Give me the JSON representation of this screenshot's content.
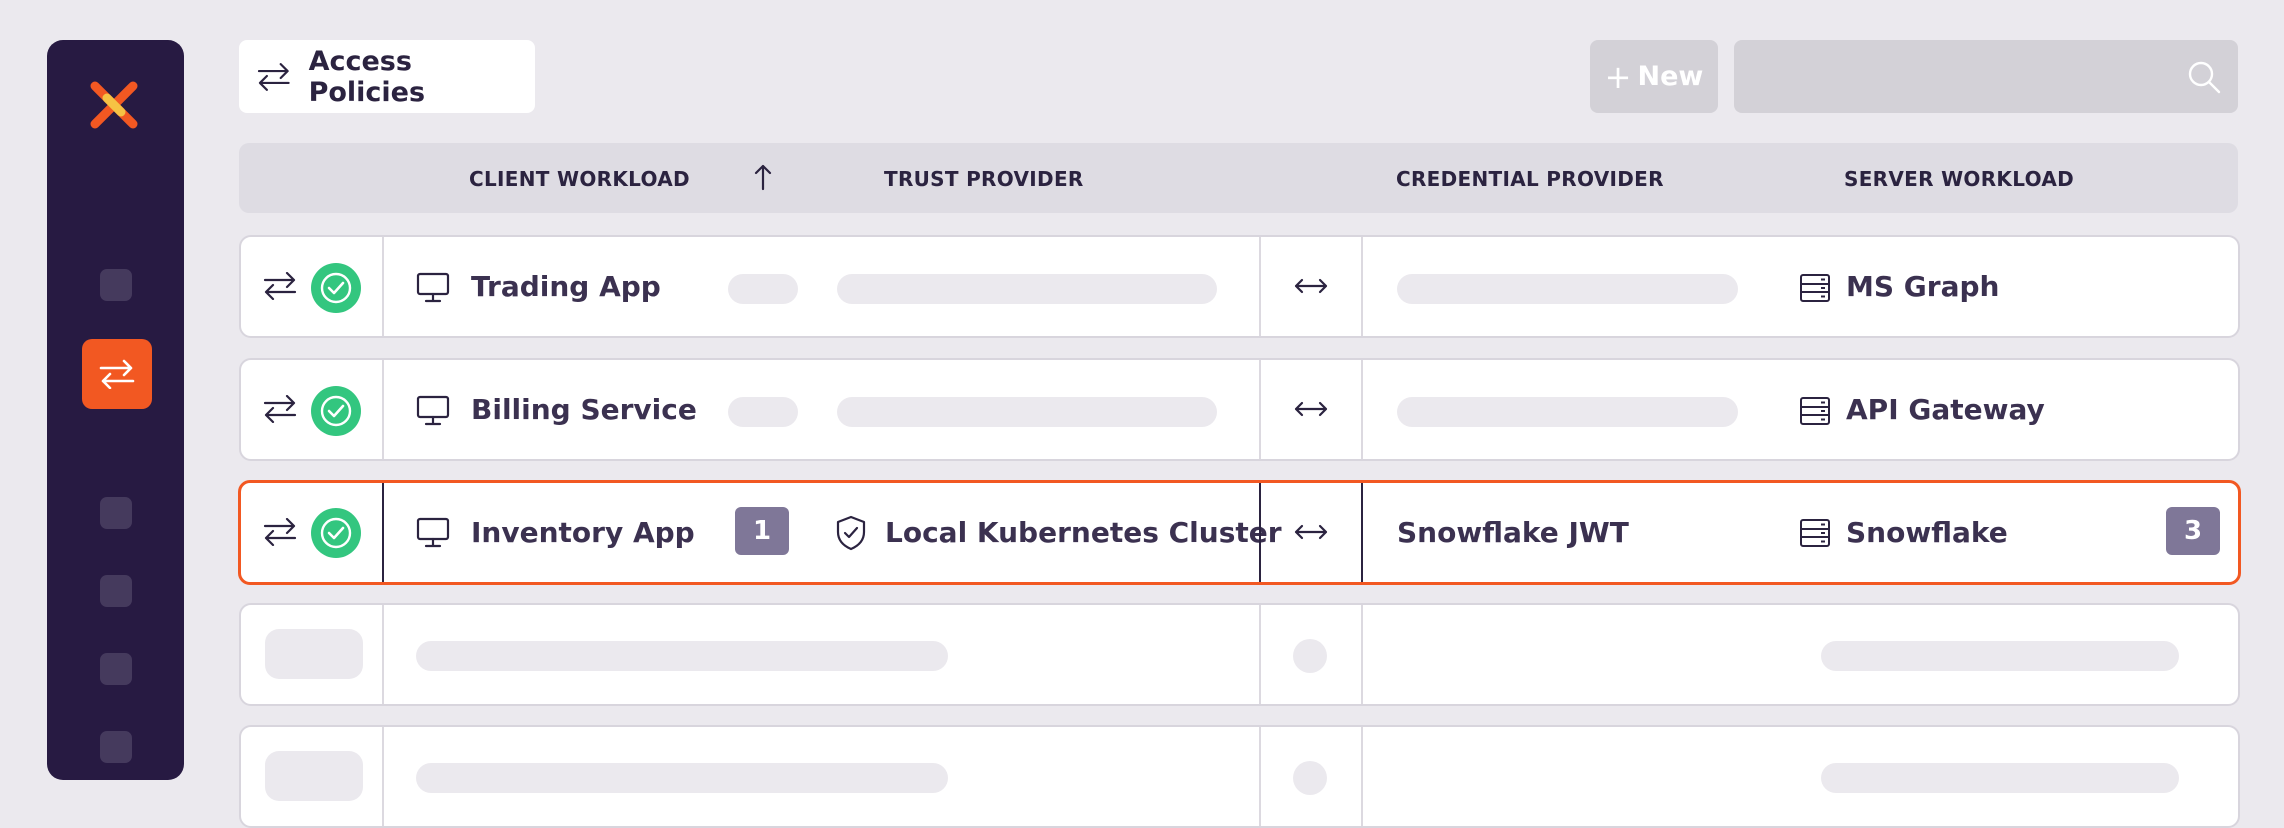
{
  "header": {
    "title": "Access Policies",
    "new_label": "New",
    "search_placeholder": ""
  },
  "colors": {
    "brand": "#f25822",
    "sidebar": "#271a42",
    "success": "#33c67f",
    "badge": "#7f7798"
  },
  "columns": {
    "client": "CLIENT WORKLOAD",
    "trust": "TRUST PROVIDER",
    "credential": "CREDENTIAL PROVIDER",
    "server": "SERVER WORKLOAD"
  },
  "rows": [
    {
      "client": "Trading App",
      "server": "MS Graph",
      "status": "active"
    },
    {
      "client": "Billing Service",
      "server": "API Gateway",
      "status": "active"
    },
    {
      "client": "Inventory App",
      "client_count": "1",
      "trust": "Local Kubernetes Cluster",
      "credential": "Snowflake JWT",
      "server": "Snowflake",
      "server_count": "3",
      "status": "active",
      "selected": true
    }
  ]
}
